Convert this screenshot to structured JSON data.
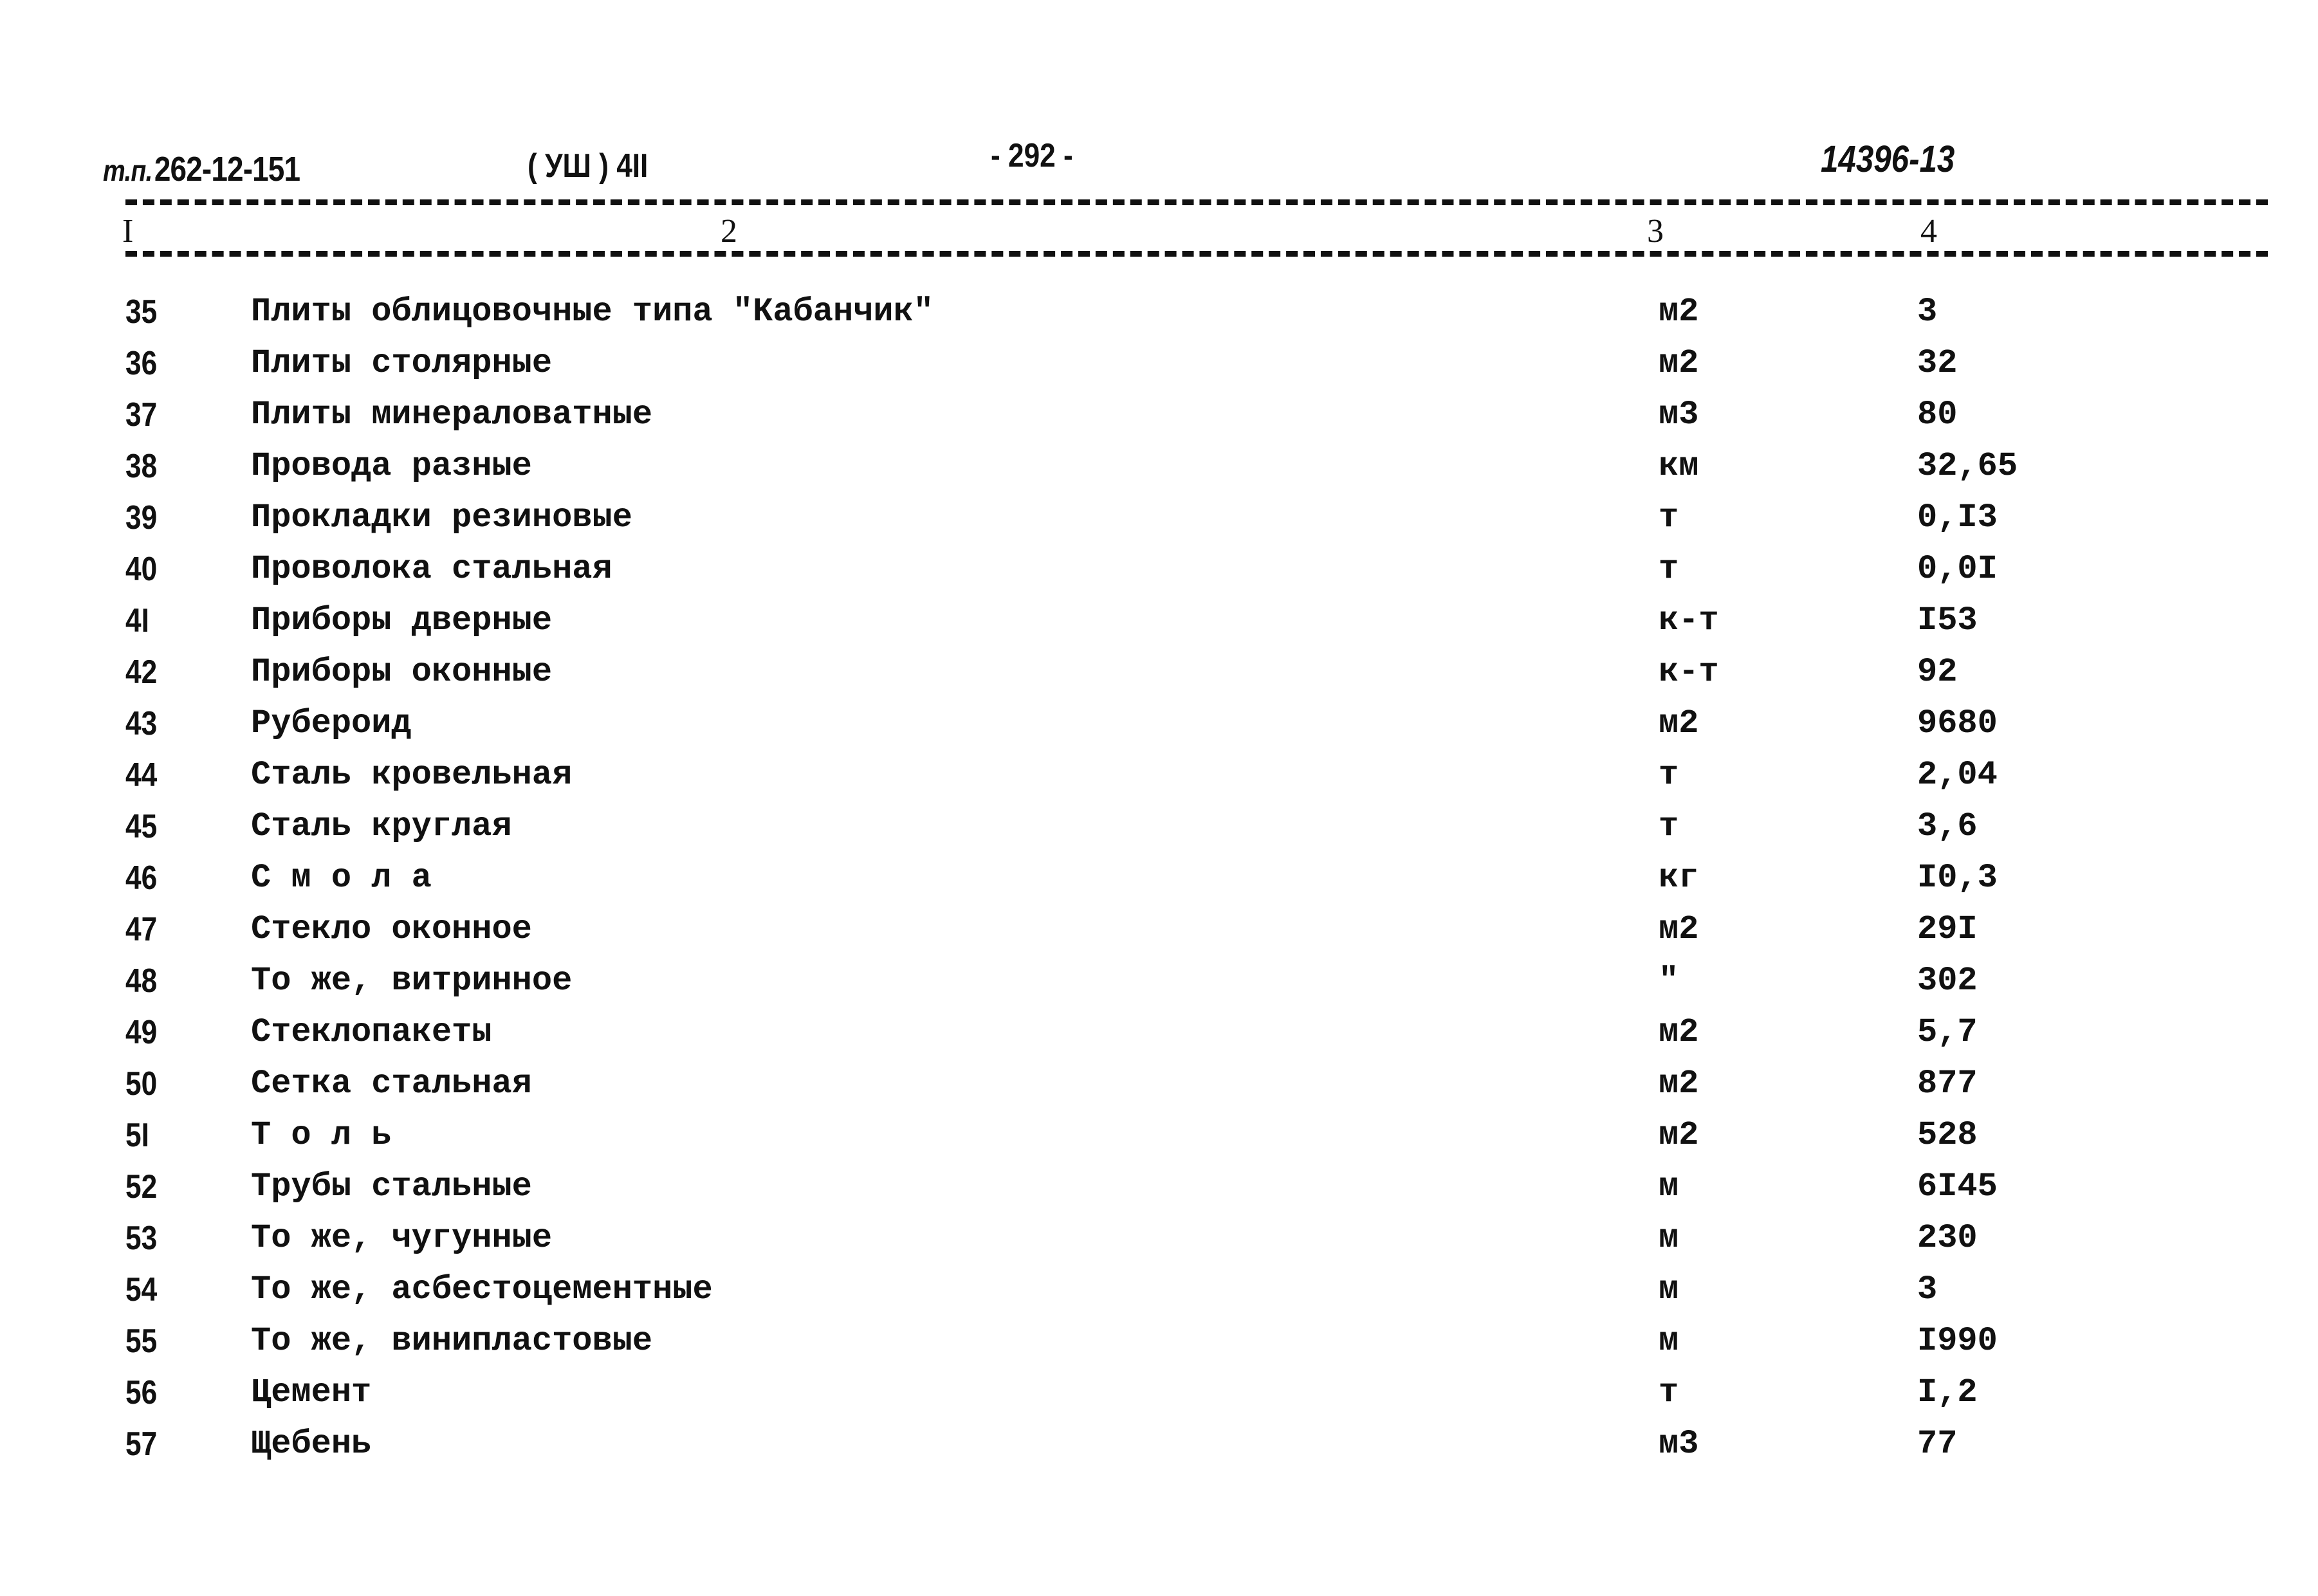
{
  "header": {
    "doc_prefix": "т.п.",
    "doc_code": "262-12-151",
    "section": "( УШ ) 4II",
    "page": "- 292 -",
    "inventory": "14396-13"
  },
  "columns": [
    "I",
    "2",
    "3",
    "4"
  ],
  "rows": [
    {
      "n": "35",
      "name": "Плиты облицовочные типа \"Кабанчик\"",
      "unit": "м2",
      "qty": "3"
    },
    {
      "n": "36",
      "name": "Плиты столярные",
      "unit": "м2",
      "qty": "32"
    },
    {
      "n": "37",
      "name": "Плиты минераловатные",
      "unit": "м3",
      "qty": "80"
    },
    {
      "n": "38",
      "name": "Провода разные",
      "unit": "км",
      "qty": "32,65"
    },
    {
      "n": "39",
      "name": "Прокладки резиновые",
      "unit": "т",
      "qty": "0,I3"
    },
    {
      "n": "40",
      "name": "Проволока стальная",
      "unit": "т",
      "qty": "0,0I"
    },
    {
      "n": "4I",
      "name": "Приборы дверные",
      "unit": "к-т",
      "qty": "I53"
    },
    {
      "n": "42",
      "name": "Приборы оконные",
      "unit": "к-т",
      "qty": "92"
    },
    {
      "n": "43",
      "name": "Рубероид",
      "unit": "м2",
      "qty": "9680"
    },
    {
      "n": "44",
      "name": "Сталь кровельная",
      "unit": "т",
      "qty": "2,04"
    },
    {
      "n": "45",
      "name": "Сталь круглая",
      "unit": "т",
      "qty": "3,6"
    },
    {
      "n": "46",
      "name": "С м о л а",
      "unit": "кг",
      "qty": "I0,3"
    },
    {
      "n": "47",
      "name": "Стекло оконное",
      "unit": "м2",
      "qty": "29I"
    },
    {
      "n": "48",
      "name": "То же, витринное",
      "unit": "\"",
      "qty": "302"
    },
    {
      "n": "49",
      "name": "Стеклопакеты",
      "unit": "м2",
      "qty": "5,7"
    },
    {
      "n": "50",
      "name": "Сетка стальная",
      "unit": "м2",
      "qty": "877"
    },
    {
      "n": "5I",
      "name": "Т о л ь",
      "unit": "м2",
      "qty": "528"
    },
    {
      "n": "52",
      "name": "Трубы стальные",
      "unit": "м",
      "qty": "6I45"
    },
    {
      "n": "53",
      "name": "То же, чугунные",
      "unit": "м",
      "qty": "230"
    },
    {
      "n": "54",
      "name": "То же, асбестоцементные",
      "unit": "м",
      "qty": "3"
    },
    {
      "n": "55",
      "name": "То же, винипластовые",
      "unit": "м",
      "qty": "I990"
    },
    {
      "n": "56",
      "name": "Цемент",
      "unit": "т",
      "qty": "I,2"
    },
    {
      "n": "57",
      "name": "Щебень",
      "unit": "м3",
      "qty": "77"
    }
  ]
}
